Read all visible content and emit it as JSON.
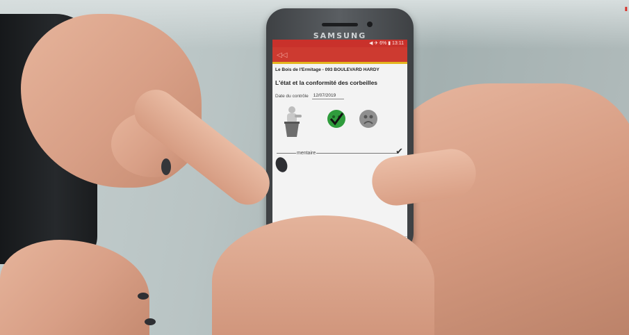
{
  "phone": {
    "brand": "SAMSUNG",
    "status_text": "◀ ✈ 6% ▮ 13:11"
  },
  "app": {
    "back_icon": "back-icon",
    "site_title": "Le Bois de l'Ermitage - 093 BOULEVARD HARDY",
    "section_title": "L'état et la conformité des corbeilles",
    "date_label": "Date du contrôle",
    "date_value": "12/07/2019",
    "comment_label": "mentaire",
    "icons": [
      "trash-bin-icon",
      "ok-check-icon",
      "sad-face-icon",
      "check-icon"
    ],
    "colors": {
      "primary": "#cd3a30",
      "accent": "#e4b51e",
      "ok": "#2f9c3c",
      "ko": "#8f8f8f"
    }
  }
}
